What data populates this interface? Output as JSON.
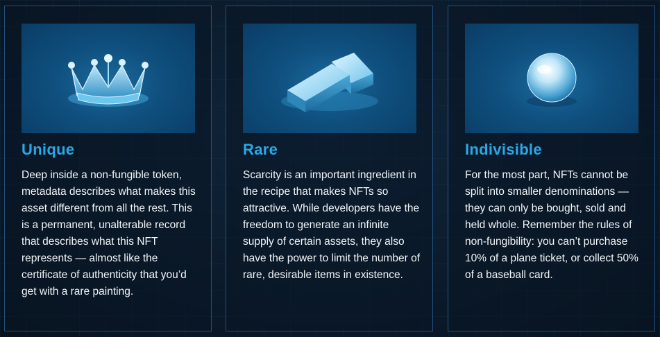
{
  "cards": [
    {
      "title": "Unique",
      "icon": "crown-icon",
      "text": "Deep inside a non-fungible token, metadata describes what makes this asset different from all the rest. This is a permanent, unalterable record that describes what this NFT represents — almost like the certificate of authenticity that you’d get with a rare painting."
    },
    {
      "title": "Rare",
      "icon": "gold-bars-icon",
      "text": "Scarcity is an important ingredient in the recipe that makes NFTs so attractive. While developers have the freedom to generate an infinite supply of certain assets, they also have the power to limit the number of rare, desirable items in existence."
    },
    {
      "title": "Indivisible",
      "icon": "sphere-icon",
      "text": "For the most part, NFTs cannot be split into smaller denominations — they can only be bought, sold and held whole. Remember the rules of non-fungibility: you can’t purchase 10% of a plane ticket, or collect 50% of a baseball card."
    }
  ],
  "colors": {
    "accent": "#29a9e8",
    "background": "#0b1a2b",
    "border": "#3a82c3",
    "text": "#f2f5f8"
  }
}
